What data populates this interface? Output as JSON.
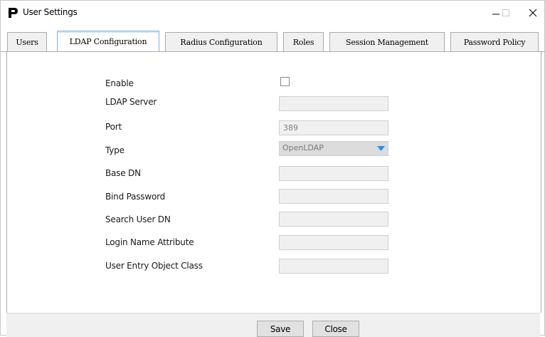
{
  "window": {
    "title": "User Settings",
    "icons": {
      "logo": "p-logo-icon",
      "minimize": "minimize-icon",
      "maximize": "maximize-icon",
      "close": "close-icon"
    }
  },
  "tabs": [
    {
      "label": "Users",
      "active": false
    },
    {
      "label": "LDAP Configuration",
      "active": true
    },
    {
      "label": "Radius Configuration",
      "active": false
    },
    {
      "label": "Roles",
      "active": false
    },
    {
      "label": "Session Management",
      "active": false
    },
    {
      "label": "Password Policy",
      "active": false
    }
  ],
  "form": {
    "enable": {
      "label": "Enable",
      "checked": false
    },
    "ldap_server": {
      "label": "LDAP Server",
      "value": ""
    },
    "port": {
      "label": "Port",
      "value": "389"
    },
    "type": {
      "label": "Type",
      "value": "OpenLDAP",
      "arrow_color": "#1e90ff"
    },
    "base_dn": {
      "label": "Base DN",
      "value": ""
    },
    "bind_password": {
      "label": "Bind Password",
      "value": ""
    },
    "search_user_dn": {
      "label": "Search User DN",
      "value": ""
    },
    "login_name_attribute": {
      "label": "Login Name Attribute",
      "value": ""
    },
    "user_entry_object_class": {
      "label": "User Entry Object Class",
      "value": ""
    }
  },
  "buttons": {
    "save": "Save",
    "close": "Close"
  },
  "colors": {
    "active_tab_border": "#7eb4ea",
    "field_background": "#f0f0f0",
    "dropdown_arrow": "#1e90ff"
  }
}
